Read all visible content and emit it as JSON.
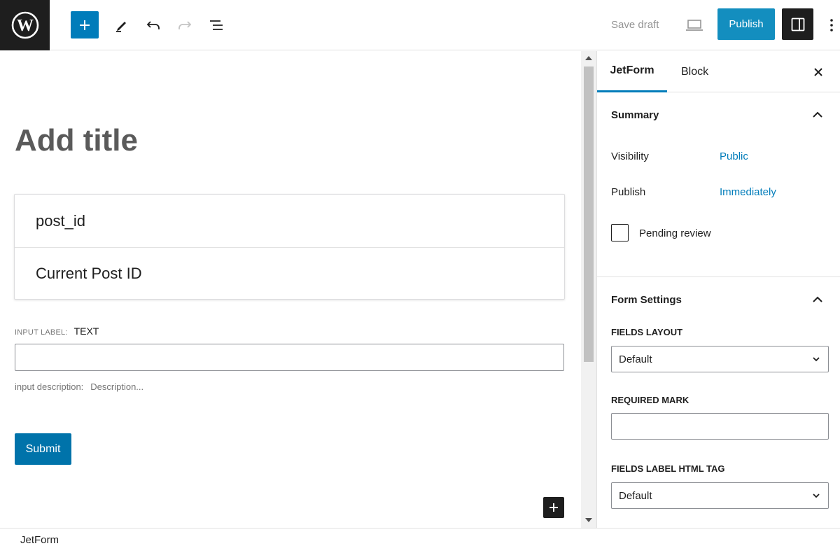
{
  "toolbar": {
    "logo_icon": "wordpress-logo",
    "inserter_icon": "plus-icon",
    "tools_icon": "pencil-icon",
    "undo_icon": "undo-icon",
    "redo_icon": "redo-icon",
    "list_view_icon": "list-view-icon",
    "save_draft_label": "Save draft",
    "preview_icon": "laptop-icon",
    "publish_label": "Publish",
    "settings_icon": "sidebar-toggle-icon",
    "more_icon": "vertical-ellipsis-icon"
  },
  "editor": {
    "title_placeholder": "Add title",
    "source_rows": [
      "post_id",
      "Current Post ID"
    ],
    "input_label_key": "INPUT LABEL:",
    "input_label_value": "TEXT",
    "description_key": "input description:",
    "description_value": "Description...",
    "submit_label": "Submit",
    "add_block_icon": "plus-icon"
  },
  "sidebar": {
    "tabs": [
      {
        "label": "JetForm",
        "active": true
      },
      {
        "label": "Block",
        "active": false
      }
    ],
    "close_icon": "close-icon",
    "summary": {
      "title": "Summary",
      "rows": [
        {
          "label": "Visibility",
          "value": "Public"
        },
        {
          "label": "Publish",
          "value": "Immediately"
        }
      ],
      "pending_review_label": "Pending review",
      "pending_review_checked": false
    },
    "form_settings": {
      "title": "Form Settings",
      "fields_layout_label": "FIELDS LAYOUT",
      "fields_layout_value": "Default",
      "required_mark_label": "REQUIRED MARK",
      "required_mark_value": "",
      "label_tag_label": "FIELDS LABEL HTML TAG",
      "label_tag_value": "Default"
    }
  },
  "footer": {
    "breadcrumb": "JetForm"
  },
  "colors": {
    "accent": "#007cba",
    "dark": "#1e1e1e",
    "muted": "#757575"
  }
}
